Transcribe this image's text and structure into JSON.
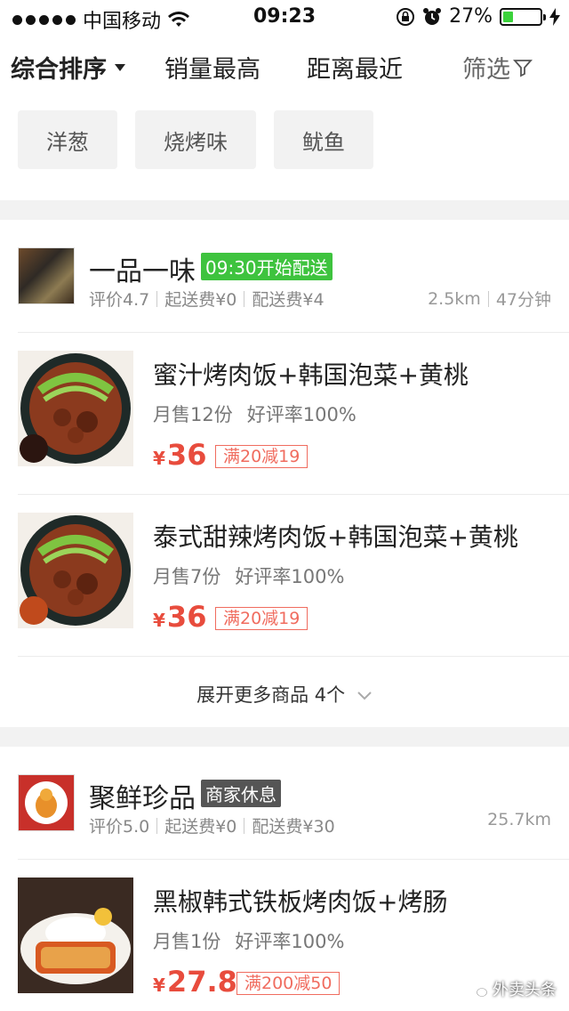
{
  "status": {
    "carrier": "中国移动",
    "time": "09:23",
    "battery": "27%",
    "battery_level": 0.27
  },
  "sort": {
    "comprehensive": "综合排序",
    "sales": "销量最高",
    "distance": "距离最近",
    "filter": "筛选"
  },
  "chips": [
    "洋葱",
    "烧烤味",
    "鱿鱼"
  ],
  "stores": [
    {
      "name": "一品一味",
      "tag": "09:30开始配送",
      "tag_color": "#3ec33e",
      "rating": "评价4.7",
      "min_fee": "起送费¥0",
      "delivery_fee": "配送费¥4",
      "distance": "2.5km",
      "time": "47分钟",
      "dishes": [
        {
          "name": "蜜汁烤肉饭+韩国泡菜+黄桃",
          "sales": "月售12份",
          "rate": "好评率100%",
          "price": "36",
          "promo": "满20减19"
        },
        {
          "name": "泰式甜辣烤肉饭+韩国泡菜+黄桃",
          "sales": "月售7份",
          "rate": "好评率100%",
          "price": "36",
          "promo": "满20减19"
        }
      ],
      "more": "展开更多商品 4个"
    },
    {
      "name": "聚鲜珍品",
      "tag": "商家休息",
      "tag_color": "#555555",
      "rating": "评价5.0",
      "min_fee": "起送费¥0",
      "delivery_fee": "配送费¥30",
      "distance": "25.7km",
      "dishes": [
        {
          "name": "黑椒韩式铁板烤肉饭+烤肠",
          "sales": "月售1份",
          "rate": "好评率100%",
          "price": "27.8",
          "promo": "满200减50"
        }
      ]
    }
  ],
  "currency": "¥",
  "watermark": "外卖头条"
}
